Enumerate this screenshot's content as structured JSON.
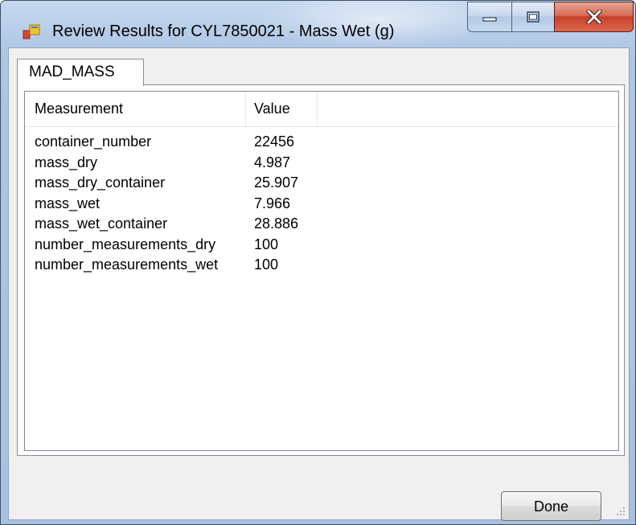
{
  "window": {
    "title": "Review Results for CYL7850021 - Mass Wet (g)",
    "icon": "app-window-icon"
  },
  "caption_buttons": {
    "minimize": "minimize-icon",
    "maximize": "maximize-icon",
    "close": "close-icon"
  },
  "tabs": [
    {
      "label": "MAD_MASS",
      "selected": true
    }
  ],
  "table": {
    "columns": [
      "Measurement",
      "Value"
    ],
    "rows": [
      {
        "measurement": "container_number",
        "value": "22456"
      },
      {
        "measurement": "mass_dry",
        "value": "4.987"
      },
      {
        "measurement": "mass_dry_container",
        "value": "25.907"
      },
      {
        "measurement": "mass_wet",
        "value": "7.966"
      },
      {
        "measurement": "mass_wet_container",
        "value": "28.886"
      },
      {
        "measurement": "number_measurements_dry",
        "value": "100"
      },
      {
        "measurement": "number_measurements_wet",
        "value": "100"
      }
    ]
  },
  "footer": {
    "done_label": "Done"
  },
  "colors": {
    "close_button": "#c7402a",
    "titlebar": "#b6cce8",
    "client_background": "#f0f0f0"
  }
}
